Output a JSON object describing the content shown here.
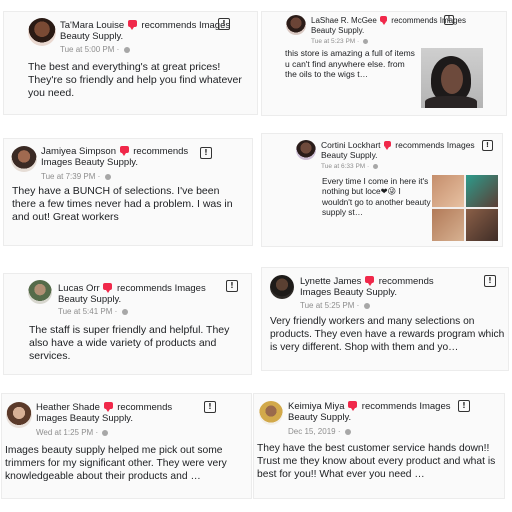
{
  "recommend_word": "recommends",
  "reviews": [
    {
      "name": "Ta'Mara Louise",
      "business": "Images Beauty Supply.",
      "time": "Tue at 5:00 PM",
      "separator": "·",
      "text": "The best and everything's at great prices! They're so friendly and help you find whatever you need.",
      "flag_icon": "report-flag-icon"
    },
    {
      "name": "LaShae R. McGee",
      "business": "Images Beauty Supply.",
      "time": "Tue at 5:23 PM",
      "separator": "·",
      "text": "this store is amazing a full of items u can't find anywhere else. from the oils to the wigs t…",
      "flag_icon": "report-flag-icon"
    },
    {
      "name": "Jamiyea Simpson",
      "business": "Images Beauty Supply.",
      "time": "Tue at 7:39 PM",
      "separator": "·",
      "text": "They have a BUNCH of selections. I've been there a few times never had a problem. I was in and out! Great workers",
      "flag_icon": "report-flag-icon"
    },
    {
      "name": "Cortini Lockhart",
      "business": "Images Beauty Supply.",
      "time": "Tue at 6:33 PM",
      "separator": "·",
      "text": "Every time I come in here it's nothing but loce❤😜 I wouldn't go to another beauty supply st…",
      "flag_icon": "report-flag-icon"
    },
    {
      "name": "Lucas Orr",
      "business": "Images Beauty Supply.",
      "time": "Tue at 5:41 PM",
      "separator": "·",
      "text": "The staff is super friendly and helpful. They also have a wide variety of products and services.",
      "flag_icon": "report-flag-icon"
    },
    {
      "name": "Lynette James",
      "business": "Images Beauty Supply.",
      "time": "Tue at 5:25 PM",
      "separator": "·",
      "text": "Very friendly workers and many selections on products. They even have a rewards program which is very different. Shop with them and yo…",
      "flag_icon": "report-flag-icon"
    },
    {
      "name": "Heather Shade",
      "business": "Images Beauty Supply.",
      "time": "Wed at 1:25 PM",
      "separator": "·",
      "text": "Images beauty supply helped me pick out some trimmers for my significant other. They were very knowledgeable about their products and …",
      "flag_icon": "report-flag-icon"
    },
    {
      "name": "Keimiya Miya",
      "business": "Images Beauty Supply.",
      "time": "Dec 15, 2019",
      "separator": "·",
      "text": "They have the best customer service hands down!! Trust me they know about every product and what is best for you!! What ever you need …",
      "flag_icon": "report-flag-icon"
    }
  ],
  "colors": {
    "recommend_badge": "#f0284a",
    "meta_text": "#8e8e8e",
    "body_text": "#1c1e21"
  }
}
